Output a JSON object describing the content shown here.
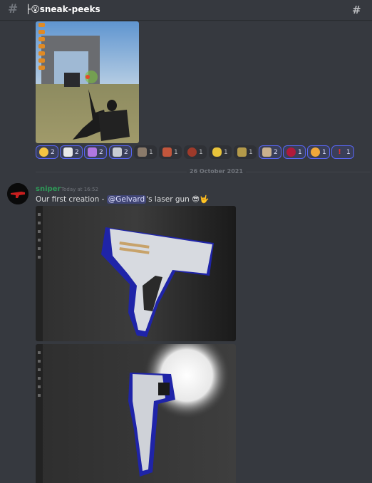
{
  "channel": {
    "name": "sneak-peeks",
    "prefix": "├😮"
  },
  "icons": {
    "hash": "hash-icon",
    "threads": "threads-icon"
  },
  "reactions": [
    {
      "emoji": "sunglasses",
      "count": "2",
      "active": true
    },
    {
      "emoji": "ghost",
      "count": "2",
      "active": true
    },
    {
      "emoji": "triangle",
      "count": "2",
      "active": true
    },
    {
      "emoji": "car",
      "count": "2",
      "active": true
    },
    {
      "emoji": "face-1",
      "count": "1",
      "active": false
    },
    {
      "emoji": "face-2",
      "count": "1",
      "active": false
    },
    {
      "emoji": "face-3",
      "count": "1",
      "active": false
    },
    {
      "emoji": "banana",
      "count": "1",
      "active": false
    },
    {
      "emoji": "dancer",
      "count": "1",
      "active": false
    },
    {
      "emoji": "dog",
      "count": "2",
      "active": true
    },
    {
      "emoji": "red-circle",
      "count": "1",
      "active": true
    },
    {
      "emoji": "swirl",
      "count": "1",
      "active": true
    },
    {
      "emoji": "exclaim",
      "count": "1",
      "active": true
    }
  ],
  "divider": {
    "date": "26 October 2021"
  },
  "message": {
    "author": "sniper",
    "timestamp": "Today at 16:52",
    "text_before": "Our first creation - ",
    "mention": "@Gelvard",
    "text_after": "'s laser gun 😎🤟"
  },
  "colors": {
    "background": "#36393f",
    "author": "#2e9b58",
    "mention_bg": "#3e4582",
    "blurple": "#5865f2"
  }
}
